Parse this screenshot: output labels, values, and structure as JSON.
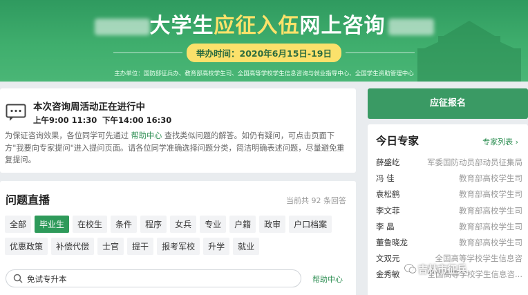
{
  "banner": {
    "title_year_obscured": "20",
    "title_part1": "大学生",
    "title_highlight": "应征入伍",
    "title_part2": "网上咨询",
    "date": "举办时间：2020年6月15日-19日",
    "organizers": "主办单位：国防部征兵办、教育部高校学生司、全国高等学校学生信息咨询与就业指导中心、全国学生资助管理中心"
  },
  "notice": {
    "title": "本次咨询周活动正在进行中",
    "time_morning": "上午9:00 11:30",
    "time_afternoon": "下午14:00 16:30",
    "desc_before": "为保证咨询效果，各位同学可先通过 ",
    "desc_link": "帮助中心",
    "desc_after": " 查找类似问题的解答。如仍有疑问，可点击页面下方\"我要向专家提问\"进入提问页面。请各位同学准确选择问题分类，简洁明确表述问题，尽量避免重复提问。"
  },
  "live": {
    "title": "问题直播",
    "count": "当前共 92 条回答",
    "tags": [
      "全部",
      "毕业生",
      "在校生",
      "条件",
      "程序",
      "女兵",
      "专业",
      "户籍",
      "政审",
      "户口档案",
      "优惠政策",
      "补偿代偿",
      "士官",
      "提干",
      "报考军校",
      "升学",
      "就业"
    ],
    "active_tag": "毕业生",
    "search_value": "免试专升本",
    "help_link": "帮助中心"
  },
  "apply": {
    "label": "应征报名"
  },
  "experts": {
    "title": "今日专家",
    "list_link": "专家列表 ›",
    "rows": [
      {
        "name": "薛盛屹",
        "org": "军委国防动员部动员征集局"
      },
      {
        "name": "冯 佳",
        "org": "教育部高校学生司"
      },
      {
        "name": "袁松鹤",
        "org": "教育部高校学生司"
      },
      {
        "name": "李文菲",
        "org": "教育部高校学生司"
      },
      {
        "name": "李 晶",
        "org": "教育部高校学生司"
      },
      {
        "name": "董鲁晓龙",
        "org": "教育部高校学生司"
      },
      {
        "name": "文双元",
        "org": "全国高等学校学生信息咨"
      },
      {
        "name": "金秀敏",
        "org": "全国高等学校学生信息咨..."
      }
    ]
  },
  "watermark": "吉林市征兵",
  "colors": {
    "brand_green": "#2e9a5a",
    "banner_green": "#3fae6d",
    "highlight_yellow": "#fde26a",
    "link_green": "#2f8f54"
  }
}
